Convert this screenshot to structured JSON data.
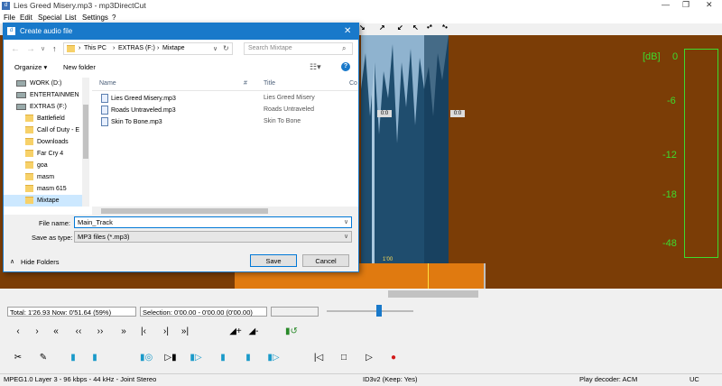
{
  "app": {
    "window_title": "Lies Greed Misery.mp3 - mp3DirectCut",
    "menu": [
      "File",
      "Edit",
      "Special",
      "List",
      "Settings",
      "?"
    ],
    "colors": {
      "wave_bg": "#7b3d06",
      "wave_fg": "#1f4d6e",
      "meter_green": "#3ddc2e",
      "accent": "#1979ca",
      "overview_orange": "#e07a10"
    }
  },
  "toolstrip_icons": [
    "↘",
    "↗",
    "↙",
    "↖",
    "•*",
    "*•"
  ],
  "db_meter": {
    "label": "[dB]",
    "ticks": [
      "0",
      "-6",
      "-12",
      "-18",
      "-48"
    ]
  },
  "wave_markers": {
    "cut_marker_1": "0:0",
    "cut_marker_2": "0:0",
    "time_label": "1'00"
  },
  "status_row": {
    "total": "Total: 1'26.93   Now: 0'51.64   (59%)",
    "selection": "Selection: 0'00.00 - 0'00.00 (0'00.00)",
    "empty_field": ""
  },
  "statusbar": {
    "format": "MPEG1.0 Layer 3 - 96 kbps - 44 kHz - Joint Stereo",
    "id3": "ID3v2 (Keep: Yes)",
    "decoder": "Play decoder: ACM",
    "mode": "UC"
  },
  "dialog": {
    "title": "Create audio file",
    "breadcrumb": [
      "This PC",
      "EXTRAS (F:)",
      "Mixtape"
    ],
    "search_placeholder": "Search Mixtape",
    "organize_label": "Organize ▾",
    "new_folder_label": "New folder",
    "tree": [
      {
        "label": "WORK (D:)",
        "type": "drive"
      },
      {
        "label": "ENTERTAINMEN",
        "type": "drive"
      },
      {
        "label": "EXTRAS (F:)",
        "type": "drive"
      },
      {
        "label": "Battlefield",
        "type": "folder"
      },
      {
        "label": "Call of Duty - E",
        "type": "folder"
      },
      {
        "label": "Downloads",
        "type": "folder"
      },
      {
        "label": "Far Cry 4",
        "type": "folder"
      },
      {
        "label": "goa",
        "type": "folder"
      },
      {
        "label": "masm",
        "type": "folder"
      },
      {
        "label": "masm 615",
        "type": "folder"
      },
      {
        "label": "Mixtape",
        "type": "folder"
      }
    ],
    "columns": [
      "Name",
      "#",
      "Title",
      "Co"
    ],
    "files": [
      {
        "name": "Lies Greed Misery.mp3",
        "title": "Lies Greed Misery"
      },
      {
        "name": "Roads Untraveled.mp3",
        "title": "Roads Untraveled"
      },
      {
        "name": "Skin To Bone.mp3",
        "title": "Skin To Bone"
      }
    ],
    "filename_label": "File name:",
    "filename_value": "Main_Track",
    "savetype_label": "Save as type:",
    "savetype_value": "MP3 files (*.mp3)",
    "hide_folders": "Hide Folders",
    "save_label": "Save",
    "cancel_label": "Cancel"
  }
}
